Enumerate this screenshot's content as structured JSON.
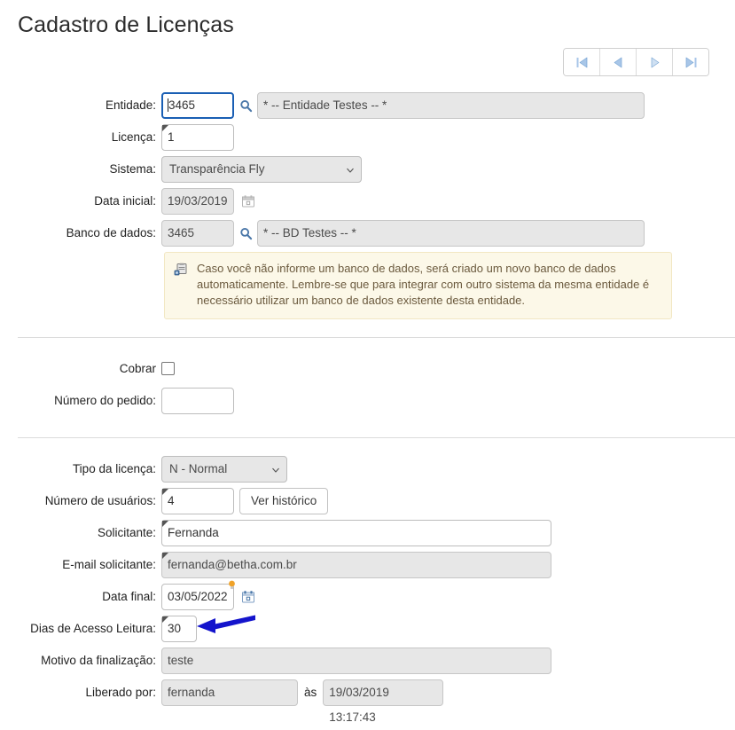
{
  "page": {
    "title": "Cadastro de Licenças"
  },
  "pager": {
    "first_label": "Primeiro",
    "prev_label": "Anterior",
    "next_label": "Próximo",
    "last_label": "Último",
    "icon_color": "#a8c6e8"
  },
  "form": {
    "entidade": {
      "label": "Entidade:",
      "value": "3465",
      "search_icon": "magnifier-icon",
      "description": "* -- Entidade Testes -- *"
    },
    "licenca": {
      "label": "Licença:",
      "value": "1"
    },
    "sistema": {
      "label": "Sistema:",
      "value": "Transparência Fly",
      "options": [
        "Transparência Fly"
      ]
    },
    "data_inicial": {
      "label": "Data inicial:",
      "value": "19/03/2019",
      "calendar_icon": "calendar-icon"
    },
    "banco_dados": {
      "label": "Banco de dados:",
      "value": "3465",
      "search_icon": "magnifier-icon",
      "description": "* -- BD Testes -- *"
    },
    "info": {
      "icon": "note-clipboard-icon",
      "text": "Caso você não informe um banco de dados, será criado um novo banco de dados automaticamente. Lembre-se que para integrar com outro sistema da mesma entidade é necessário utilizar um banco de dados existente desta entidade."
    },
    "cobrar": {
      "label": "Cobrar",
      "checked": false
    },
    "numero_pedido": {
      "label": "Número do pedido:",
      "value": ""
    },
    "tipo_licenca": {
      "label": "Tipo da licença:",
      "value": "N - Normal",
      "options": [
        "N - Normal"
      ]
    },
    "numero_usuarios": {
      "label": "Número de usuários:",
      "value": "4",
      "history_button": "Ver histórico"
    },
    "solicitante": {
      "label": "Solicitante:",
      "value": "Fernanda"
    },
    "email_solicitante": {
      "label": "E-mail solicitante:",
      "value": "fernanda@betha.com.br"
    },
    "data_final": {
      "label": "Data final:",
      "value": "03/05/2022",
      "hint_icon": "lightbulb-icon",
      "calendar_icon": "calendar-icon"
    },
    "dias_acesso_leitura": {
      "label": "Dias de Acesso Leitura:",
      "value": "30"
    },
    "motivo_finalizacao": {
      "label": "Motivo da finalização:",
      "value": "teste"
    },
    "liberado_por": {
      "label": "Liberado por:",
      "value": "fernanda",
      "separator": "às",
      "timestamp": "19/03/2019 13:17:43"
    }
  },
  "annotation": {
    "arrow": "left-arrow-annotation",
    "color": "#1414cc"
  }
}
